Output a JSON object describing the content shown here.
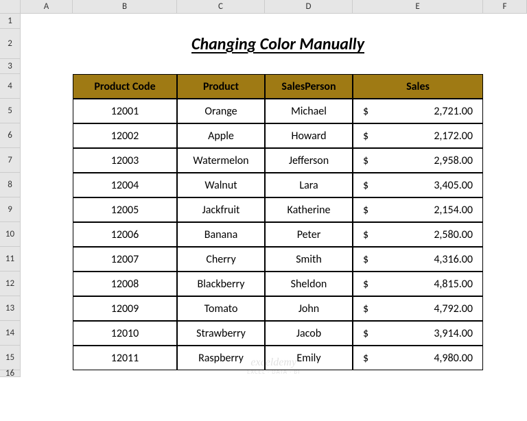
{
  "columns": [
    "A",
    "B",
    "C",
    "D",
    "E",
    "F"
  ],
  "row_numbers": [
    "1",
    "2",
    "3",
    "4",
    "5",
    "6",
    "7",
    "8",
    "9",
    "10",
    "11",
    "12",
    "13",
    "14",
    "15",
    "16"
  ],
  "title": "Changing Color Manually",
  "headers": {
    "code": "Product Code",
    "product": "Product",
    "person": "SalesPerson",
    "sales": "Sales"
  },
  "currency_symbol": "$",
  "data": [
    {
      "code": "12001",
      "product": "Orange",
      "person": "Michael",
      "sales": "2,721.00"
    },
    {
      "code": "12002",
      "product": "Apple",
      "person": "Howard",
      "sales": "2,172.00"
    },
    {
      "code": "12003",
      "product": "Watermelon",
      "person": "Jefferson",
      "sales": "2,958.00"
    },
    {
      "code": "12004",
      "product": "Walnut",
      "person": "Lara",
      "sales": "3,405.00"
    },
    {
      "code": "12005",
      "product": "Jackfruit",
      "person": "Katherine",
      "sales": "2,154.00"
    },
    {
      "code": "12006",
      "product": "Banana",
      "person": "Peter",
      "sales": "2,580.00"
    },
    {
      "code": "12007",
      "product": "Cherry",
      "person": "Smith",
      "sales": "4,316.00"
    },
    {
      "code": "12008",
      "product": "Blackberry",
      "person": "Sheldon",
      "sales": "4,815.00"
    },
    {
      "code": "12009",
      "product": "Tomato",
      "person": "John",
      "sales": "4,792.00"
    },
    {
      "code": "12010",
      "product": "Strawberry",
      "person": "Jacob",
      "sales": "3,914.00"
    },
    {
      "code": "12011",
      "product": "Raspberry",
      "person": "Emily",
      "sales": "4,980.00"
    }
  ],
  "watermark": {
    "brand": "exceldemy",
    "tagline": "EXCEL · DATA · BI"
  }
}
